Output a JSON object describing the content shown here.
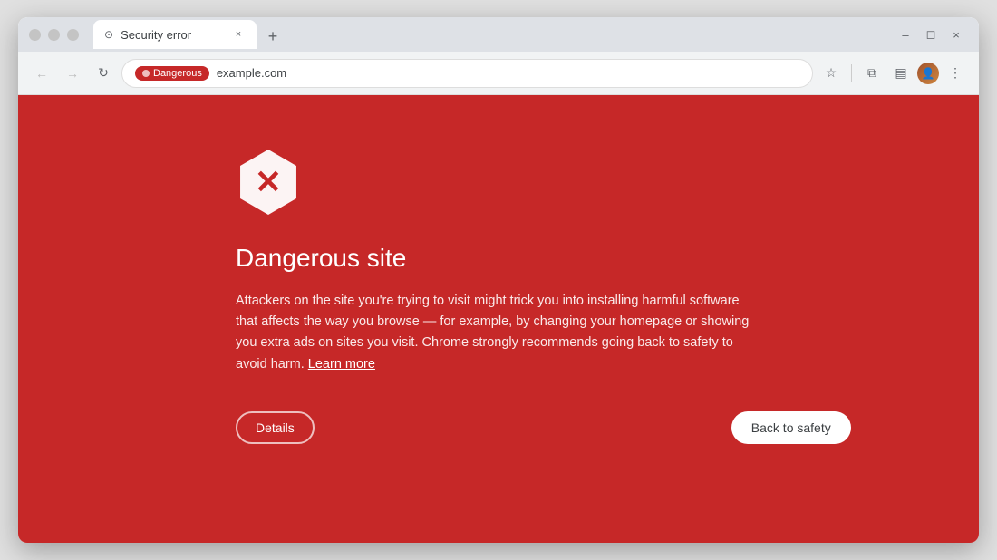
{
  "browser": {
    "tab": {
      "title": "Security error",
      "close_label": "×"
    },
    "new_tab_label": "+",
    "window_controls": {
      "minimize_label": "–",
      "maximize_label": "◻",
      "close_label": "×"
    }
  },
  "toolbar": {
    "back_label": "←",
    "forward_label": "→",
    "reload_label": "↻",
    "danger_badge_label": "Dangerous",
    "address": "example.com",
    "bookmark_label": "☆",
    "extensions_label": "⧉",
    "sidebar_label": "▤",
    "menu_label": "⋮"
  },
  "error_page": {
    "icon_label": "✕",
    "title": "Dangerous site",
    "body_text": "Attackers on the site you're trying to visit might trick you into installing harmful software that affects the way you browse — for example, by changing your homepage or showing you extra ads on sites you visit. Chrome strongly recommends going back to safety to avoid harm.",
    "learn_more_label": "Learn more",
    "details_button_label": "Details",
    "safety_button_label": "Back to safety"
  },
  "colors": {
    "error_bg": "#c62828",
    "badge_bg": "#b71c1c"
  }
}
